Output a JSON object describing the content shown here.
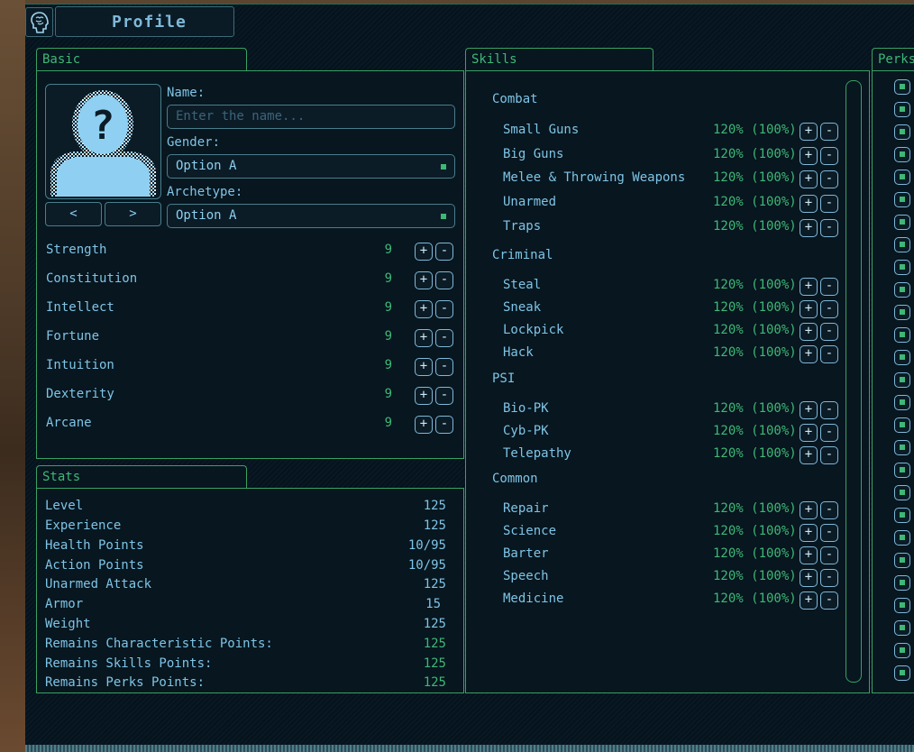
{
  "header": {
    "title": "Profile",
    "icon": "brain-head-icon"
  },
  "basic": {
    "tab_label": "Basic",
    "name_label": "Name:",
    "name_placeholder": "Enter the name...",
    "gender_label": "Gender:",
    "gender_value": "Option A",
    "archetype_label": "Archetype:",
    "archetype_value": "Option A",
    "prev_label": "<",
    "next_label": ">",
    "plus": "+",
    "minus": "-",
    "attributes": [
      {
        "name": "Strength",
        "value": "9"
      },
      {
        "name": "Constitution",
        "value": "9"
      },
      {
        "name": "Intellect",
        "value": "9"
      },
      {
        "name": "Fortune",
        "value": "9"
      },
      {
        "name": "Intuition",
        "value": "9"
      },
      {
        "name": "Dexterity",
        "value": "9"
      },
      {
        "name": "Arcane",
        "value": "9"
      }
    ]
  },
  "stats": {
    "tab_label": "Stats",
    "rows": [
      {
        "name": "Level",
        "value": "125"
      },
      {
        "name": "Experience",
        "value": "125"
      },
      {
        "name": "Health Points",
        "value": "10/95"
      },
      {
        "name": "Action Points",
        "value": "10/95"
      },
      {
        "name": "Unarmed Attack",
        "value": "125"
      },
      {
        "name": "Armor",
        "value": "15"
      },
      {
        "name": "Weight",
        "value": "125"
      },
      {
        "name": "Remains Characteristic Points:",
        "value": "125"
      },
      {
        "name": "Remains Skills Points:",
        "value": "125"
      },
      {
        "name": "Remains Perks Points:",
        "value": "125"
      }
    ]
  },
  "skills": {
    "tab_label": "Skills",
    "categories": [
      {
        "name": "Combat",
        "skills": [
          {
            "name": "Small Guns",
            "value": "120% (100%)"
          },
          {
            "name": "Big Guns",
            "value": "120% (100%)"
          },
          {
            "name": "Melee & Throwing Weapons",
            "value": "120% (100%)"
          },
          {
            "name": "Unarmed",
            "value": "120% (100%)"
          },
          {
            "name": "Traps",
            "value": "120% (100%)"
          }
        ]
      },
      {
        "name": "Criminal",
        "skills": [
          {
            "name": "Steal",
            "value": "120% (100%)"
          },
          {
            "name": "Sneak",
            "value": "120% (100%)"
          },
          {
            "name": "Lockpick",
            "value": "120% (100%)"
          },
          {
            "name": "Hack",
            "value": "120% (100%)"
          }
        ]
      },
      {
        "name": "PSI",
        "skills": [
          {
            "name": "Bio-PK",
            "value": "120% (100%)"
          },
          {
            "name": "Cyb-PK",
            "value": "120% (100%)"
          },
          {
            "name": "Telepathy",
            "value": "120% (100%)"
          }
        ]
      },
      {
        "name": "Common",
        "skills": [
          {
            "name": "Repair",
            "value": "120% (100%)"
          },
          {
            "name": "Science",
            "value": "120% (100%)"
          },
          {
            "name": "Barter",
            "value": "120% (100%)"
          },
          {
            "name": "Speech",
            "value": "120% (100%)"
          },
          {
            "name": "Medicine",
            "value": "120% (100%)"
          }
        ]
      }
    ]
  },
  "perks": {
    "tab_label": "Perks",
    "count": 27
  },
  "colors": {
    "accent_green": "#3fb876",
    "text_blue": "#7fc4e6",
    "border_blue": "#4a7d8c",
    "panel_bg": "#07161f"
  }
}
